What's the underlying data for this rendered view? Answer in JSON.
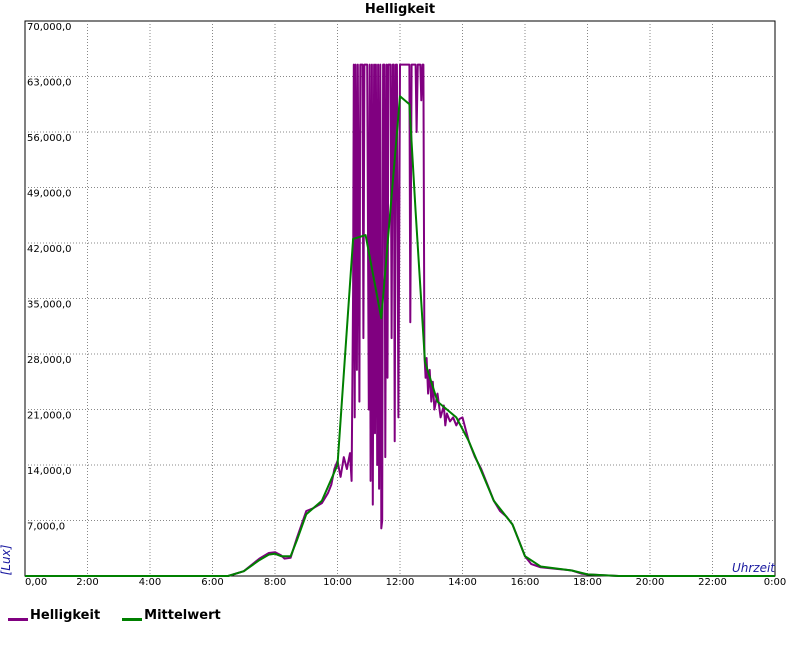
{
  "chart_data": {
    "type": "line",
    "title": "Helligkeit",
    "xlabel": "Uhrzeit",
    "ylabel": "[Lux]",
    "xlim": [
      0,
      24
    ],
    "ylim": [
      0,
      70000
    ],
    "x_ticks": [
      0,
      2,
      4,
      6,
      8,
      10,
      12,
      14,
      16,
      18,
      20,
      22,
      24
    ],
    "x_tick_labels": [
      "0,00",
      "2:00",
      "4:00",
      "6:00",
      "8:00",
      "10:00",
      "12:00",
      "14:00",
      "16:00",
      "18:00",
      "20:00",
      "22:00",
      "0:00"
    ],
    "y_ticks": [
      0,
      7000,
      14000,
      21000,
      28000,
      35000,
      42000,
      49000,
      56000,
      63000,
      70000
    ],
    "y_tick_labels": [
      "",
      "7,000,0",
      "14,000,0",
      "21,000,0",
      "28,000,0",
      "35,000,0",
      "42,000,0",
      "49,000,0",
      "56,000,0",
      "63,000,0",
      "70,000,0"
    ],
    "grid": true,
    "legend_position": "bottom-left",
    "series": [
      {
        "name": "Helligkeit",
        "color": "#800080",
        "points": [
          [
            0,
            0
          ],
          [
            6.5,
            0
          ],
          [
            7.0,
            600
          ],
          [
            7.5,
            2200
          ],
          [
            7.8,
            2900
          ],
          [
            8.0,
            3000
          ],
          [
            8.2,
            2600
          ],
          [
            8.3,
            2200
          ],
          [
            8.5,
            2300
          ],
          [
            8.7,
            4800
          ],
          [
            9.0,
            8200
          ],
          [
            9.2,
            8500
          ],
          [
            9.5,
            9200
          ],
          [
            9.7,
            10500
          ],
          [
            9.8,
            11500
          ],
          [
            9.9,
            13500
          ],
          [
            10.0,
            14500
          ],
          [
            10.1,
            12500
          ],
          [
            10.2,
            15000
          ],
          [
            10.3,
            13500
          ],
          [
            10.4,
            15500
          ],
          [
            10.45,
            12000
          ],
          [
            10.5,
            36000
          ],
          [
            10.52,
            64500
          ],
          [
            10.55,
            20000
          ],
          [
            10.58,
            64500
          ],
          [
            10.62,
            26000
          ],
          [
            10.65,
            64500
          ],
          [
            10.7,
            22000
          ],
          [
            10.73,
            64500
          ],
          [
            10.8,
            64500
          ],
          [
            10.83,
            30000
          ],
          [
            10.86,
            64500
          ],
          [
            10.95,
            64500
          ],
          [
            11.0,
            21000
          ],
          [
            11.03,
            64500
          ],
          [
            11.06,
            12000
          ],
          [
            11.1,
            64500
          ],
          [
            11.13,
            9000
          ],
          [
            11.17,
            64500
          ],
          [
            11.2,
            18000
          ],
          [
            11.23,
            64500
          ],
          [
            11.27,
            14000
          ],
          [
            11.3,
            64500
          ],
          [
            11.33,
            11000
          ],
          [
            11.37,
            64500
          ],
          [
            11.4,
            6000
          ],
          [
            11.43,
            7000
          ],
          [
            11.46,
            64500
          ],
          [
            11.5,
            64500
          ],
          [
            11.53,
            15000
          ],
          [
            11.57,
            64500
          ],
          [
            11.6,
            25000
          ],
          [
            11.63,
            64500
          ],
          [
            11.7,
            64500
          ],
          [
            11.73,
            30000
          ],
          [
            11.77,
            64500
          ],
          [
            11.8,
            64500
          ],
          [
            11.83,
            17000
          ],
          [
            11.87,
            64500
          ],
          [
            11.9,
            64500
          ],
          [
            11.95,
            20000
          ],
          [
            12.0,
            64500
          ],
          [
            12.3,
            64500
          ],
          [
            12.33,
            32000
          ],
          [
            12.37,
            64500
          ],
          [
            12.5,
            64500
          ],
          [
            12.53,
            56000
          ],
          [
            12.57,
            64500
          ],
          [
            12.65,
            64500
          ],
          [
            12.68,
            60000
          ],
          [
            12.72,
            64500
          ],
          [
            12.75,
            64500
          ],
          [
            12.78,
            28000
          ],
          [
            12.82,
            25000
          ],
          [
            12.85,
            27500
          ],
          [
            12.9,
            23000
          ],
          [
            12.95,
            26000
          ],
          [
            13.0,
            22000
          ],
          [
            13.05,
            24500
          ],
          [
            13.1,
            21000
          ],
          [
            13.2,
            23000
          ],
          [
            13.3,
            20000
          ],
          [
            13.4,
            21500
          ],
          [
            13.45,
            19000
          ],
          [
            13.5,
            20500
          ],
          [
            13.6,
            19500
          ],
          [
            13.7,
            20000
          ],
          [
            13.8,
            19000
          ],
          [
            13.9,
            19800
          ],
          [
            14.0,
            20000
          ],
          [
            14.1,
            18500
          ],
          [
            14.2,
            17000
          ],
          [
            14.4,
            15000
          ],
          [
            14.6,
            13500
          ],
          [
            14.8,
            11500
          ],
          [
            15.0,
            9500
          ],
          [
            15.2,
            8200
          ],
          [
            15.4,
            7500
          ],
          [
            15.6,
            6500
          ],
          [
            15.8,
            4500
          ],
          [
            16.0,
            2500
          ],
          [
            16.2,
            1500
          ],
          [
            16.5,
            1100
          ],
          [
            17.0,
            900
          ],
          [
            17.3,
            800
          ],
          [
            17.5,
            700
          ],
          [
            17.8,
            300
          ],
          [
            18.0,
            200
          ],
          [
            18.5,
            100
          ],
          [
            19.0,
            0
          ],
          [
            24.0,
            0
          ]
        ]
      },
      {
        "name": "Mittelwert",
        "color": "#008000",
        "points": [
          [
            0,
            0
          ],
          [
            6.5,
            0
          ],
          [
            7.0,
            600
          ],
          [
            7.5,
            2000
          ],
          [
            7.8,
            2700
          ],
          [
            8.0,
            2800
          ],
          [
            8.2,
            2500
          ],
          [
            8.5,
            2500
          ],
          [
            8.7,
            4500
          ],
          [
            9.0,
            7800
          ],
          [
            9.5,
            9500
          ],
          [
            10.0,
            14000
          ],
          [
            10.5,
            42500
          ],
          [
            10.9,
            43000
          ],
          [
            11.4,
            32500
          ],
          [
            12.0,
            60500
          ],
          [
            12.3,
            59500
          ],
          [
            12.5,
            46000
          ],
          [
            12.8,
            27000
          ],
          [
            13.2,
            22000
          ],
          [
            13.8,
            20000
          ],
          [
            14.2,
            17000
          ],
          [
            15.0,
            9500
          ],
          [
            15.6,
            6500
          ],
          [
            16.0,
            2500
          ],
          [
            16.5,
            1200
          ],
          [
            17.5,
            700
          ],
          [
            18.0,
            200
          ],
          [
            19.0,
            0
          ],
          [
            24.0,
            0
          ]
        ]
      }
    ]
  }
}
